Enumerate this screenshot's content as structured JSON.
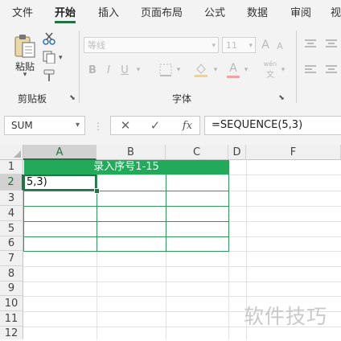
{
  "ribbon_tabs": [
    {
      "label": "文件"
    },
    {
      "label": "开始"
    },
    {
      "label": "插入"
    },
    {
      "label": "页面布局"
    },
    {
      "label": "公式"
    },
    {
      "label": "数据"
    },
    {
      "label": "审阅"
    },
    {
      "label": "视"
    }
  ],
  "clipboard": {
    "paste_label": "粘贴",
    "group_label": "剪贴板"
  },
  "font_group": {
    "font_name": "等线",
    "font_size": "11",
    "bold": "B",
    "italic": "I",
    "underline": "U",
    "font_color_letter": "A",
    "pinyin_label": "wén",
    "group_label": "字体"
  },
  "formula_bar": {
    "name_box": "SUM",
    "fx": "fx",
    "formula": "=SEQUENCE(5,3)"
  },
  "grid": {
    "columns": [
      "A",
      "B",
      "C",
      "D",
      "F"
    ],
    "rows": [
      "1",
      "2",
      "3",
      "4",
      "5",
      "6",
      "7",
      "8",
      "9",
      "10",
      "11",
      "12"
    ],
    "merged_title": "录入序号1-15",
    "active_cell_text": "5,3)",
    "selected_column": "A",
    "selected_row": "2"
  },
  "watermark": "软件技巧",
  "colors": {
    "accent": "#217346",
    "header_fill": "#22aa5a"
  }
}
